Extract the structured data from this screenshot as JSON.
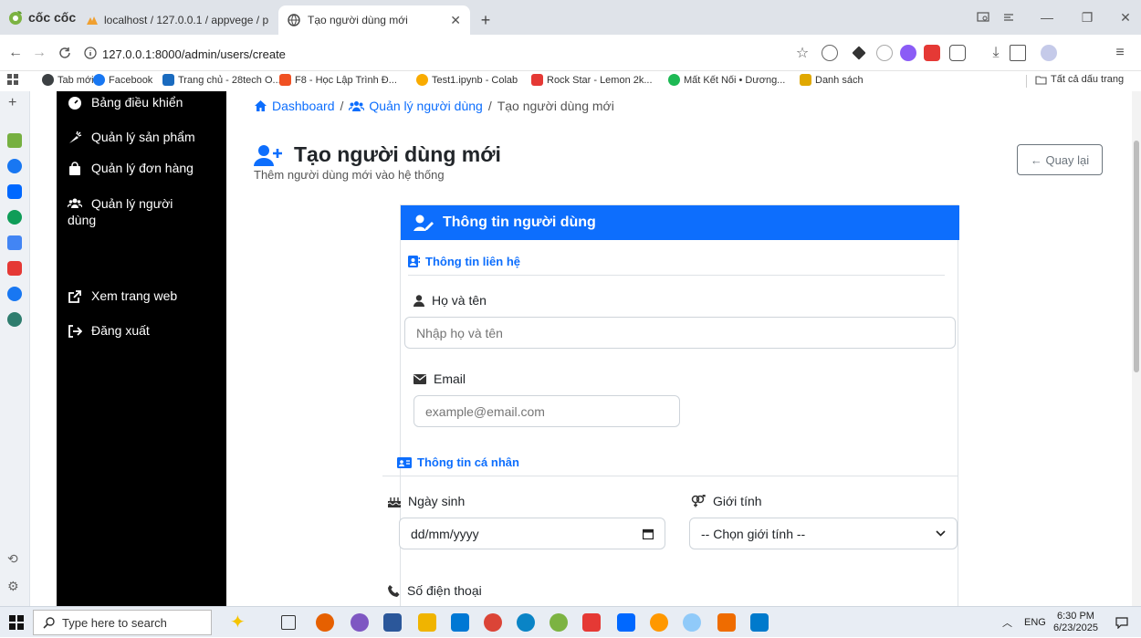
{
  "browser": {
    "brand": "cốc cốc",
    "tabs": [
      {
        "label": "localhost / 127.0.0.1 / appvege / p",
        "active": false
      },
      {
        "label": "Tạo người dùng mới",
        "active": true
      }
    ],
    "new_tab": "+",
    "url": "127.0.0.1:8000/admin/users/create",
    "bookmarks": [
      {
        "label": "Tab mới",
        "color": "#3c4043"
      },
      {
        "label": "Facebook",
        "color": "#1877f2"
      },
      {
        "label": "Trang chủ - 28tech O...",
        "color": "#1a6bbf"
      },
      {
        "label": "F8 - Học Lập Trình Đ...",
        "color": "#f05123"
      },
      {
        "label": "Test1.ipynb - Colab",
        "color": "#f9ab00"
      },
      {
        "label": "Rock Star - Lemon 2k...",
        "color": "#e53935"
      },
      {
        "label": "Mất Kết Nối • Dương...",
        "color": "#1db954"
      },
      {
        "label": "Danh sách",
        "color": "#e0a800"
      }
    ],
    "bookmarks_all": "Tất cả dấu trang"
  },
  "sidebar": {
    "items": [
      {
        "label": "Bảng điều khiển",
        "icon": "dashboard-icon"
      },
      {
        "label": "Quản lý sản phẩm",
        "icon": "carrot-icon"
      },
      {
        "label": "Quản lý đơn hàng",
        "icon": "shopping-bag-icon"
      },
      {
        "label": "Quản lý người",
        "label2": "dùng",
        "icon": "users-icon"
      },
      {
        "label": "Xem trang web",
        "icon": "external-link-icon"
      },
      {
        "label": "Đăng xuất",
        "icon": "sign-out-icon"
      }
    ]
  },
  "breadcrumb": {
    "home": "Dashboard",
    "users": "Quản lý người dùng",
    "current": "Tạo người dùng mới",
    "sep": "/"
  },
  "page": {
    "title": "Tạo người dùng mới",
    "subtitle": "Thêm người dùng mới vào hệ thống",
    "back_button": "← Quay lại"
  },
  "form": {
    "header": "Thông tin người dùng",
    "contact_section": "Thông tin liên hệ",
    "fullname_label": "Họ và tên",
    "fullname_placeholder": "Nhập họ và tên",
    "email_label": "Email",
    "email_placeholder": "example@email.com",
    "personal_section": "Thông tin cá nhân",
    "dob_label": "Ngày sinh",
    "dob_placeholder": "dd/mm/yyyy",
    "gender_label": "Giới tính",
    "gender_selected": "-- Chọn giới tính --",
    "phone_label": "Số điện thoại"
  },
  "taskbar": {
    "search_placeholder": "Type here to search",
    "lang": "ENG",
    "time": "6:30 PM",
    "date": "6/23/2025"
  },
  "colors": {
    "primary": "#0d6efd",
    "sidebar_bg": "#000000"
  }
}
